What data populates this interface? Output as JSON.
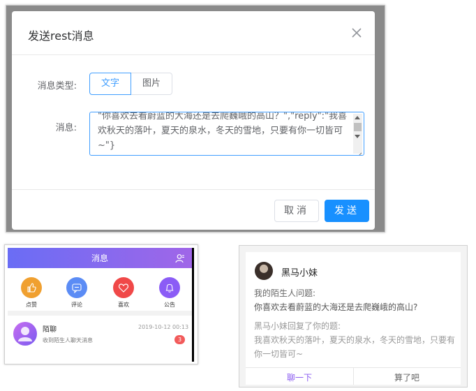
{
  "dialog": {
    "title": "发送rest消息",
    "type_label": "消息类型:",
    "type_options": [
      "文字",
      "图片"
    ],
    "message_label": "消息:",
    "message_value": "\"你喜欢去看蔚蓝的大海还是去爬巍峨的高山？\",\"reply\":\"我喜欢秋天的落叶，夏天的泉水，冬天的雪地，只要有你一切皆可~\"}",
    "cancel_label": "取消",
    "send_label": "发送"
  },
  "phone": {
    "title": "消息",
    "quick_items": [
      "点赞",
      "评论",
      "喜欢",
      "公告"
    ],
    "chat": {
      "name": "陌聊",
      "time": "2019-10-12 00:13",
      "message": "收到陌生人聊天消息",
      "badge": "3"
    }
  },
  "card": {
    "name": "黑马小妹",
    "question_label": "我的陌生人问题:",
    "question": "你喜欢去看蔚蓝的大海还是去爬巍峨的高山?",
    "reply_label": "黑马小妹回复了你的题:",
    "reply": "我喜欢秋天的落叶，夏天的泉水，冬天的雪地，只要有你一切皆可~",
    "btn_chat": "聊一下",
    "btn_skip": "算了吧"
  },
  "colors": {
    "primary": "#1890ff",
    "accent_purple": "#8c5df0",
    "icon_like": "#f0a030",
    "icon_comment": "#5b8cf5",
    "icon_favorite": "#f04848",
    "icon_notice": "#8b5cf6"
  }
}
